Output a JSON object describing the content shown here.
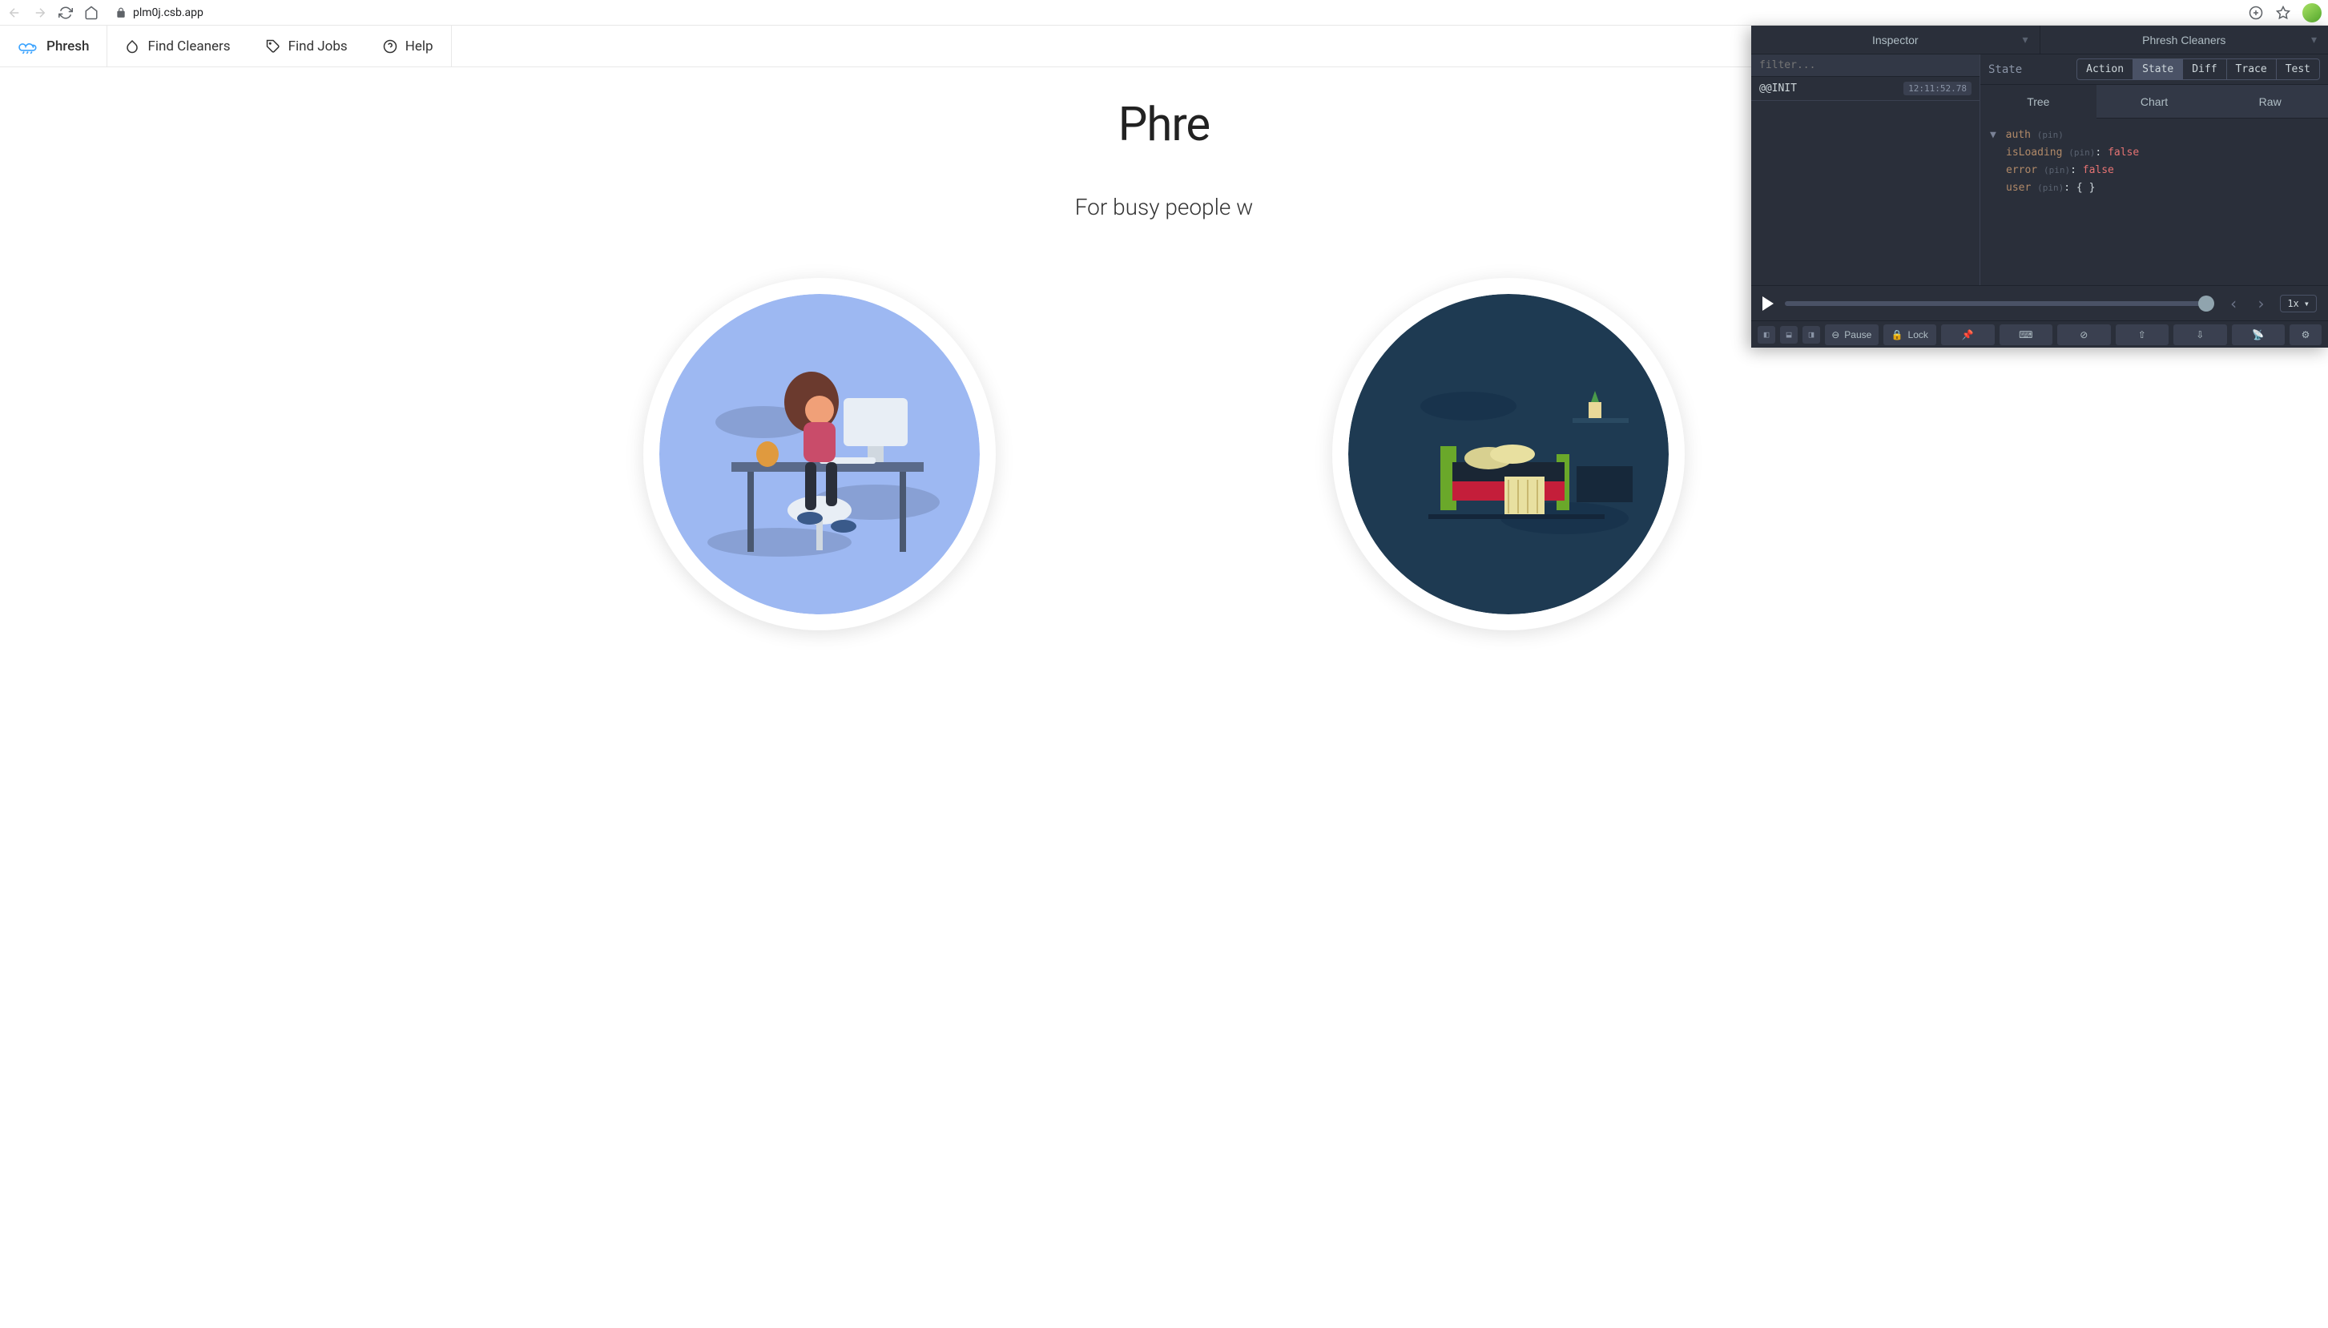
{
  "browser": {
    "url": "plm0j.csb.app"
  },
  "nav": {
    "logo": "Phresh",
    "items": [
      "Find Cleaners",
      "Find Jobs",
      "Help"
    ]
  },
  "hero": {
    "title": "Phre",
    "subtitle": "For busy people w"
  },
  "devtools": {
    "top_left": "Inspector",
    "top_right": "Phresh Cleaners",
    "filter_placeholder": "filter...",
    "actions": [
      {
        "name": "@@INIT",
        "time": "12:11:52.78"
      }
    ],
    "state_label": "State",
    "view_buttons": [
      "Action",
      "State",
      "Diff",
      "Trace",
      "Test"
    ],
    "view_active": "State",
    "subtabs": [
      "Tree",
      "Chart",
      "Raw"
    ],
    "subtab_active": "Tree",
    "tree": {
      "root": "auth",
      "pin": "(pin)",
      "children": [
        {
          "key": "isLoading",
          "val": "false",
          "type": "bool"
        },
        {
          "key": "error",
          "val": "false",
          "type": "bool"
        },
        {
          "key": "user",
          "val": "{ }",
          "type": "obj"
        }
      ]
    },
    "speed": "1x",
    "bottom": {
      "pause": "Pause",
      "lock": "Lock"
    }
  }
}
